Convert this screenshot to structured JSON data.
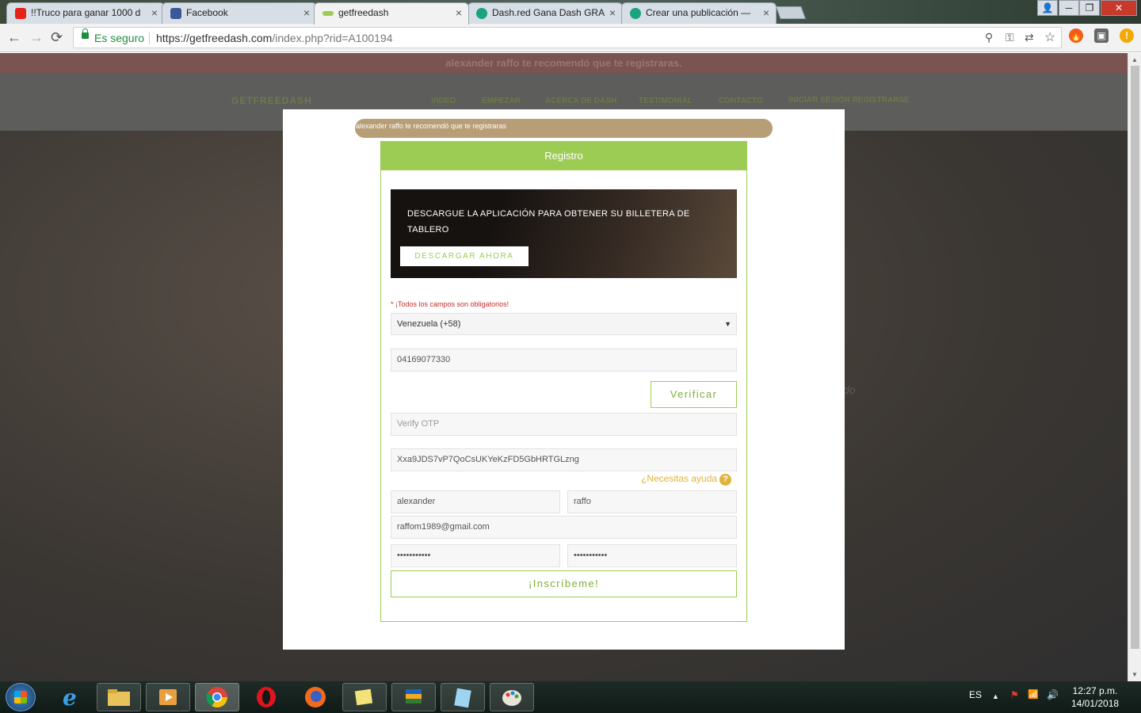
{
  "browser": {
    "tabs": [
      {
        "title": "!!Truco para ganar 1000 d",
        "favicon": "youtube-icon",
        "color": "#e62117"
      },
      {
        "title": "Facebook",
        "favicon": "facebook-icon",
        "color": "#3b5998"
      },
      {
        "title": "getfreedash",
        "favicon": "getfreedash-icon",
        "color": "#9dcc55"
      },
      {
        "title": "Dash.red Gana Dash GRA",
        "favicon": "dash-red-icon",
        "color": "#1aa37c"
      },
      {
        "title": "Crear una publicación —",
        "favicon": "dash-red-icon",
        "color": "#1aa37c"
      }
    ],
    "tab_close": "×",
    "window_controls": {
      "user": "👤",
      "minimize": "─",
      "maximize": "❐",
      "close": "✕"
    },
    "nav": {
      "back": "←",
      "forward": "→",
      "reload": "⟳"
    },
    "omnibox": {
      "secure_label": "Es seguro",
      "url_host": "https://getfreedash.com",
      "url_path": "/index.php?rid=A100194"
    },
    "omnibox_icons": {
      "zoom": "⚲",
      "key": "⚿",
      "translate": "⇄",
      "star": "☆"
    },
    "extensions": {
      "fire": "🔥",
      "bag": "▣",
      "alert": "!"
    }
  },
  "background_page": {
    "referral_bar": "alexander raffo te recomendó que te registraras.",
    "logo": "GETFREEDASH",
    "nav_items": [
      "VIDEO",
      "EMPEZAR",
      "ACERCA DE DASH",
      "TESTIMONIAL",
      "CONTACTO",
      "INICIAR SESIÓN REGISTRARSE"
    ],
    "side_text": "do"
  },
  "scrollbar": {
    "up": "▲",
    "down": "▼"
  },
  "modal": {
    "referral_pill": "alexander raffo te recomendó que te registraras",
    "card_title": "Registro",
    "promo": {
      "text": "DESCARGUE LA APLICACIÓN PARA OBTENER SU BILLETERA DE TABLERO",
      "button": "DESCARGAR AHORA"
    },
    "required_note": "* ¡Todos los campos son obligatorios!",
    "country": {
      "value": "Venezuela (+58)",
      "caret": "▼"
    },
    "phone": "04169077330",
    "verify_button": "Verificar",
    "otp_placeholder": "Verify OTP",
    "captcha_value": "Xxa9JDS7vP7QoCsUKYeKzFD5GbHRTGLzng",
    "help": {
      "label": "¿Necesitas ayuda",
      "icon": "?"
    },
    "first_name": "alexander",
    "last_name": "raffo",
    "email": "raffom1989@gmail.com",
    "password": "•••••••••••",
    "password_confirm": "•••••••••••",
    "submit_button": "¡Inscríbeme!"
  },
  "taskbar": {
    "apps": [
      "start-button",
      "internet-explorer-icon",
      "file-explorer-icon",
      "media-player-icon",
      "chrome-icon",
      "opera-icon",
      "firefox-icon",
      "sticky-notes-icon",
      "bluestacks-icon",
      "notepad-icon",
      "paint-icon"
    ],
    "language": "ES",
    "tray_icons": {
      "show_hidden": "▲",
      "network": "📶",
      "volume": "🔊",
      "flag": "⚑"
    },
    "time": "12:27 p.m.",
    "date": "14/01/2018"
  }
}
